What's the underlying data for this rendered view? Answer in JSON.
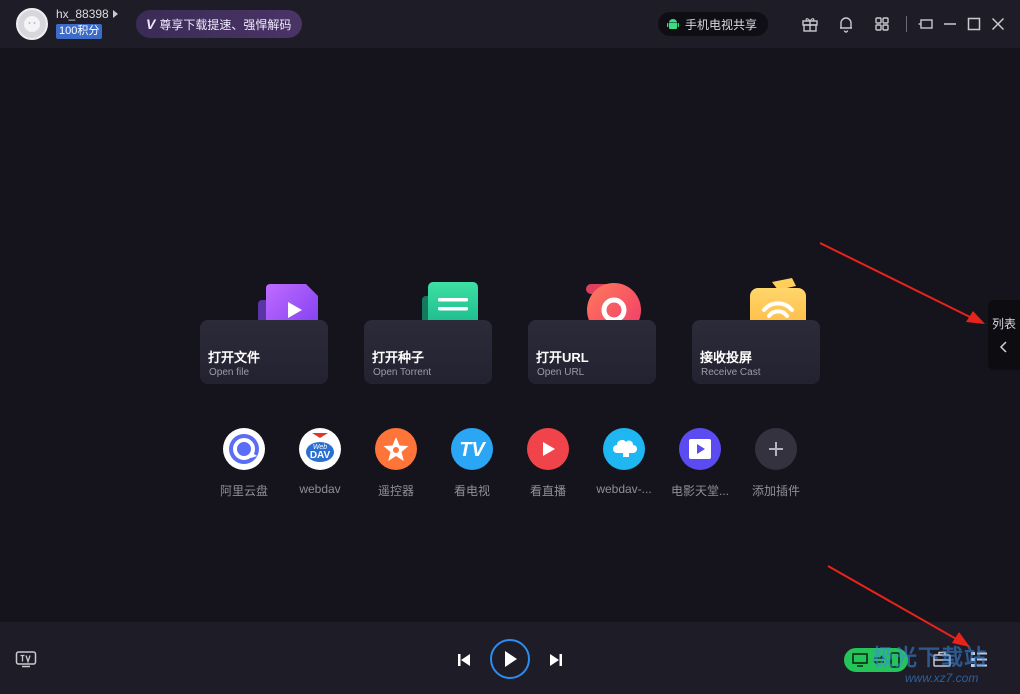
{
  "titlebar": {
    "username": "hx_88398",
    "points": "100积分",
    "vip_promo": "尊享下载提速、强悍解码",
    "phone_tv_share": "手机电视共享"
  },
  "cards": [
    {
      "title": "打开文件",
      "subtitle": "Open file"
    },
    {
      "title": "打开种子",
      "subtitle": "Open Torrent"
    },
    {
      "title": "打开URL",
      "subtitle": "Open URL"
    },
    {
      "title": "接收投屏",
      "subtitle": "Receive Cast"
    }
  ],
  "plugins": [
    {
      "label": "阿里云盘"
    },
    {
      "label": "webdav"
    },
    {
      "label": "遥控器"
    },
    {
      "label": "看电视"
    },
    {
      "label": "看直播"
    },
    {
      "label": "webdav-..."
    },
    {
      "label": "电影天堂..."
    },
    {
      "label": "添加插件"
    }
  ],
  "side_tab": {
    "label": "列表"
  },
  "icons": {
    "webdav_top": "Web",
    "webdav_bottom": "DAV",
    "tv_text": "TV"
  },
  "watermark": {
    "text": "极光下载站",
    "url": "www.xz7.com"
  },
  "colors": {
    "accent_blue": "#2d8cf0",
    "cast_green": "#25c45a",
    "arrow_red": "#e8231b"
  }
}
